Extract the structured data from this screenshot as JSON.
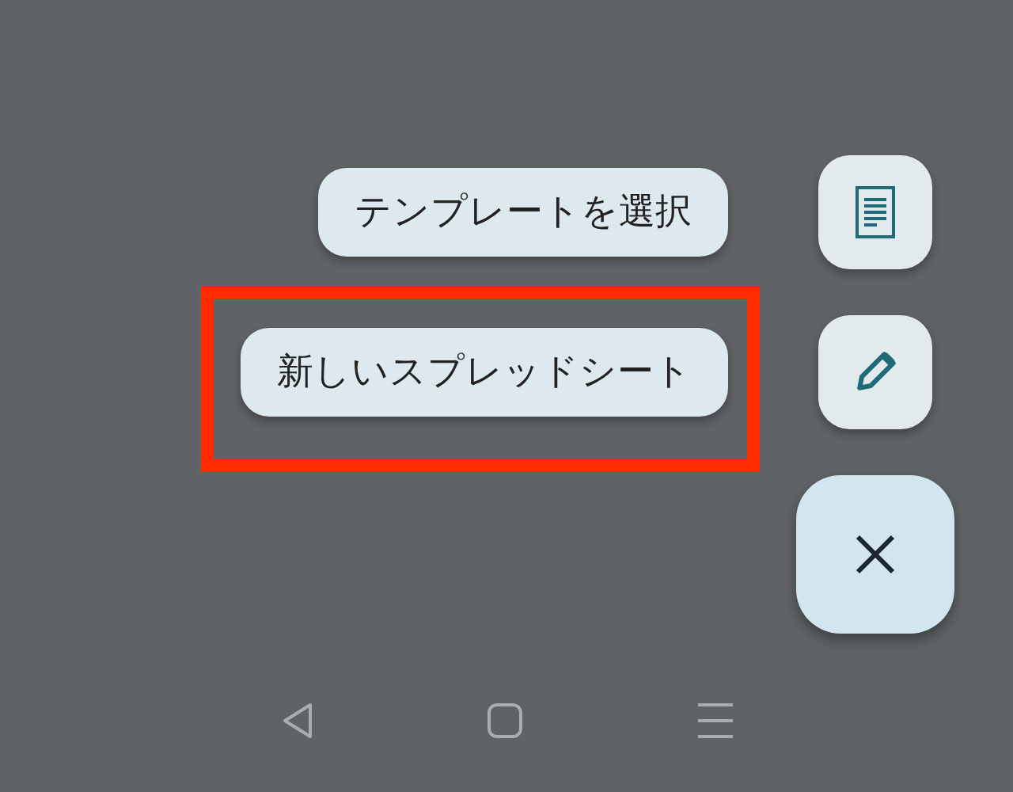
{
  "speed_dial": {
    "actions": [
      {
        "label": "テンプレートを選択",
        "kind": "template",
        "highlighted": false
      },
      {
        "label": "新しいスプレッドシート",
        "kind": "new",
        "highlighted": true
      }
    ],
    "close_button": {
      "kind": "close"
    }
  },
  "nav_bar": {
    "buttons": [
      {
        "kind": "back"
      },
      {
        "kind": "home"
      },
      {
        "kind": "menu"
      }
    ]
  }
}
